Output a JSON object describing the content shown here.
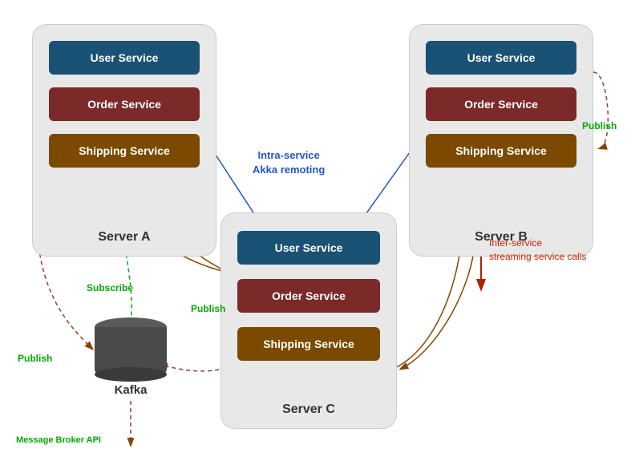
{
  "servers": {
    "a": {
      "label": "Server A",
      "services": {
        "user": "User Service",
        "order": "Order Service",
        "shipping": "Shipping Service"
      }
    },
    "b": {
      "label": "Server B",
      "services": {
        "user": "User Service",
        "order": "Order Service",
        "shipping": "Shipping Service"
      }
    },
    "c": {
      "label": "Server C",
      "services": {
        "user": "User Service",
        "order": "Order Service",
        "shipping": "Shipping Service"
      }
    }
  },
  "kafka": {
    "label": "Kafka",
    "api_label": "Message Broker API"
  },
  "annotations": {
    "intra_service": "Intra-service\nAkka remoting",
    "inter_service": "Inter-service\nstreaming service calls",
    "publish_b": "Publish",
    "subscribe": "Subscribe",
    "publish_kafka": "Publish",
    "publish_c": "Publish"
  }
}
